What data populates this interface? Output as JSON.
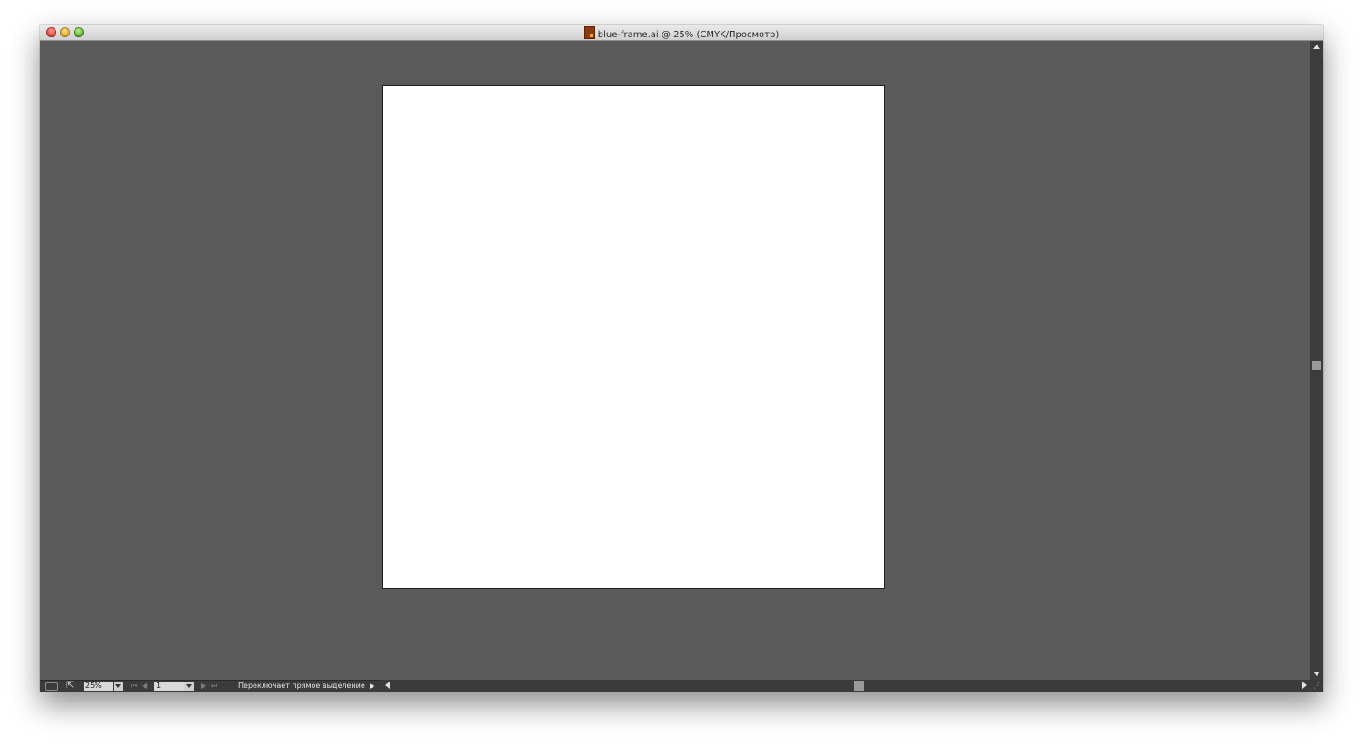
{
  "window": {
    "title": "blue-frame.ai @ 25% (CMYK/Просмотр)",
    "doc_icon": "illustrator-doc-icon"
  },
  "statusbar": {
    "zoom_value": "25%",
    "artboard_value": "1",
    "status_text": "Переключает прямое выделение",
    "nav_first": "⏮",
    "nav_prev": "◀",
    "nav_next": "▶",
    "nav_last": "⏭",
    "status_menu_arrow": "▶"
  },
  "colors": {
    "canvas_background": "#5a5a5a",
    "artboard_fill": "#ffffff",
    "scrollbar_track": "#3c3c3c"
  }
}
